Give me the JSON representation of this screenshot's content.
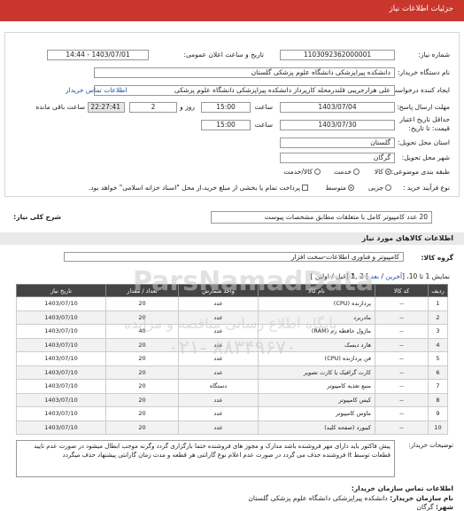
{
  "header": {
    "title": "جزئیات اطلاعات نیاز"
  },
  "form": {
    "need_number_label": "شماره نیاز:",
    "need_number": "1103092362000001",
    "announce_label": "تاریخ و ساعت اعلان عمومی:",
    "announce_value": "1403/07/01 - 14:44",
    "buyer_name_label": "نام دستگاه خریدار:",
    "buyer_name": "دانشکده پیراپزشکی دانشگاه علوم پزشکی گلستان",
    "creator_label": "ایجاد کننده درخواست:",
    "creator": "علی هزارجریبی قلندرمحله کارپرداز دانشکده پیراپزشکی دانشگاه علوم پزشکی",
    "buyer_contact_link": "اطلاعات تماس خریدار",
    "reply_deadline_label": "مهلت ارسال پاسخ: تا تاریخ:",
    "reply_date": "1403/07/04",
    "time_label": "ساعت",
    "reply_time": "15:00",
    "days_value": "2",
    "days_label": "روز و",
    "remaining_time": "22:27:41",
    "remaining_label": "ساعت باقی مانده",
    "validity_label_1": "حداقل تاریخ اعتبار",
    "validity_label_2": "قیمت: تا تاریخ:",
    "validity_date": "1403/07/30",
    "validity_time": "15:00",
    "province_label": "استان محل تحویل:",
    "province": "گلستان",
    "city_label": "شهر محل تحویل:",
    "city": "گرگان",
    "category_label": "طبقه بندی موضوعی:",
    "category_options": [
      "کالا",
      "خدمت",
      "کالا/خدمت"
    ],
    "process_label": "نوع فرآیند خرید :",
    "process_options": [
      "جزیی",
      "متوسط"
    ],
    "payment_text": "پرداخت تمام یا بخشی از مبلغ خرید،از محل \"اسناد خزانه اسلامی\" خواهد بود."
  },
  "need_summary": {
    "label": "شرح کلی نیاز:",
    "value": "20 عدد کامپیوتر کامل با متعلقات مطابق مشخصات پیوست"
  },
  "goods_section": {
    "title": "اطلاعات کالاهای مورد نیاز",
    "group_label": "گروه کالا:",
    "group_value": "کامپیوتر و فناوری اطلاعات-سخت افزار"
  },
  "pager": {
    "prefix": "نمایش 1 تا 10، [",
    "last": "آخرین",
    "sep1": " / ",
    "next": "بعد",
    "mid": " ] 2 ,",
    "current": "1",
    "sep2": " [",
    "prev": "قبل",
    "sep3": " / ",
    "first": "اولین",
    "suffix": " ]"
  },
  "table": {
    "headers": [
      "ردیف",
      "کد کالا",
      "نام کالا",
      "واحد شمارش",
      "تعداد / مقدار",
      "تاریخ نیاز"
    ],
    "rows": [
      {
        "n": "1",
        "code": "--",
        "name": "پردازنده (CPU)",
        "unit": "عدد",
        "qty": "20",
        "date": "1403/07/10"
      },
      {
        "n": "2",
        "code": "--",
        "name": "مادربرد",
        "unit": "عدد",
        "qty": "20",
        "date": "1403/07/10"
      },
      {
        "n": "3",
        "code": "--",
        "name": "ماژول حافظه رم (RAM)",
        "unit": "عدد",
        "qty": "40",
        "date": "1403/07/10"
      },
      {
        "n": "4",
        "code": "--",
        "name": "هارد دیسک",
        "unit": "عدد",
        "qty": "20",
        "date": "1403/07/10"
      },
      {
        "n": "5",
        "code": "--",
        "name": "فن پردازنده (CPU)",
        "unit": "عدد",
        "qty": "20",
        "date": "1403/07/10"
      },
      {
        "n": "6",
        "code": "--",
        "name": "کارت گرافیک یا کارت تصویر",
        "unit": "عدد",
        "qty": "20",
        "date": "1403/07/10"
      },
      {
        "n": "7",
        "code": "--",
        "name": "منبع تغذیه کامپیوتر",
        "unit": "دستگاه",
        "qty": "20",
        "date": "1403/07/10"
      },
      {
        "n": "8",
        "code": "--",
        "name": "کیس کامپیوتر",
        "unit": "عدد",
        "qty": "20",
        "date": "1403/07/10"
      },
      {
        "n": "9",
        "code": "--",
        "name": "ماوس کامپیوتر",
        "unit": "عدد",
        "qty": "20",
        "date": "1403/07/10"
      },
      {
        "n": "10",
        "code": "--",
        "name": "کیبورد (صفحه کلید)",
        "unit": "عدد",
        "qty": "20",
        "date": "1403/07/10"
      }
    ]
  },
  "notes": {
    "label": "توضیحات خریدار:",
    "text": "پیش فاکتور باید دارای مهر فروشنده باشد مدارک و مجوز های فروشنده حتما بارگزاری گردد وگرنه موجب ابطال میشود در صورت عدم تایید قطعات توسط it فروشنده حذف می گردد در صورت عدم اعلام نوع گارانتی هر قطعه و مدت زمان گارانتی پیشنهاد حذف میگردد"
  },
  "contact": {
    "title": "اطلاعات تماس سازمان خریدار:",
    "buyer_label": "نام سازمان خریدار:",
    "buyer_value": "دانشکده پیراپزشکی دانشگاه علوم پزشکی گلستان",
    "city_label": "شهر:",
    "city_value": "گرگان"
  },
  "watermark": {
    "brand": "ParsNamadData",
    "line1": "پایگاه اطلاع رسانی مناقصه و مزایده",
    "phone": "۰۲۱- ۸۸۳۴۹۶۷۰"
  },
  "colors": {
    "header": "#c9372c",
    "table_head": "#444444",
    "link": "#1a4f9c"
  }
}
